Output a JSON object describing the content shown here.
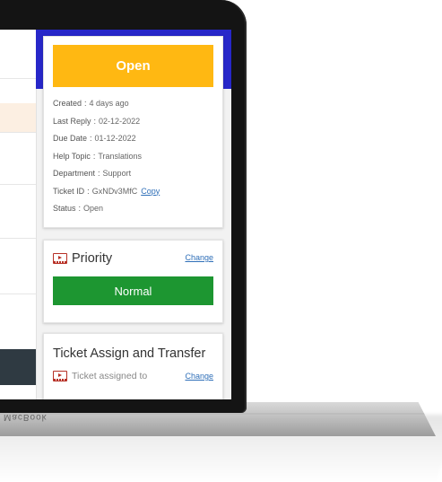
{
  "status_card": {
    "status_label": "Open",
    "fields": [
      {
        "key": "Created",
        "value": "4 days ago"
      },
      {
        "key": "Last Reply",
        "value": "02-12-2022"
      },
      {
        "key": "Due Date",
        "value": "01-12-2022"
      },
      {
        "key": "Help Topic",
        "value": "Translations"
      },
      {
        "key": "Department",
        "value": "Support"
      },
      {
        "key": "Ticket ID",
        "value": "GxNDv3MfC"
      },
      {
        "key": "Status",
        "value": "Open"
      }
    ],
    "copy_label": "Copy"
  },
  "priority_card": {
    "title": "Priority",
    "change_label": "Change",
    "priority_value": "Normal"
  },
  "assign_card": {
    "title": "Ticket Assign and Transfer",
    "assigned_label": "Ticket assigned to",
    "change_label": "Change"
  },
  "device": {
    "bezel_text": "MacBook"
  },
  "colors": {
    "header_blue": "#2727c9",
    "status_open": "#ffb812",
    "priority_normal": "#1d9631",
    "link": "#2f6fb8",
    "icon_red": "#b73026"
  },
  "icons": [
    "video-icon"
  ]
}
